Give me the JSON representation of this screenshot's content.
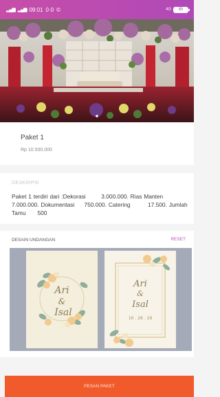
{
  "status_bar": {
    "signal_1": "4G",
    "signal_2": "4G",
    "time": "09:01",
    "extra": "0·0",
    "network": "4G",
    "battery": "85"
  },
  "hero": {
    "image_desc_icon": "wedding-stage-photo",
    "carousel_active_index": 0
  },
  "package": {
    "title": "Paket 1",
    "price": "Rp 10.500.000"
  },
  "description": {
    "label": "DESKRIPSI",
    "text": "Paket 1 terdiri dari :Dekorasi        3.000.000. Rias Manten 7.000.000. Dokumentasi     750.000. Catering         17.500. Jumlah Tamu      500"
  },
  "design": {
    "label": "DESAIN UNDANGAN",
    "reset_label": "RESET",
    "card_left": {
      "name_1": "Ari",
      "amp": "&",
      "name_2": "Isal"
    },
    "card_right": {
      "name_1": "Ari",
      "amp": "&",
      "name_2": "Isal",
      "date": "10 . 26 . 19"
    }
  },
  "order_button": {
    "label": "PESAN PAKET"
  },
  "colors": {
    "status_bar": "#c64ea8",
    "accent": "#c44db1",
    "button": "#f15a2b"
  }
}
